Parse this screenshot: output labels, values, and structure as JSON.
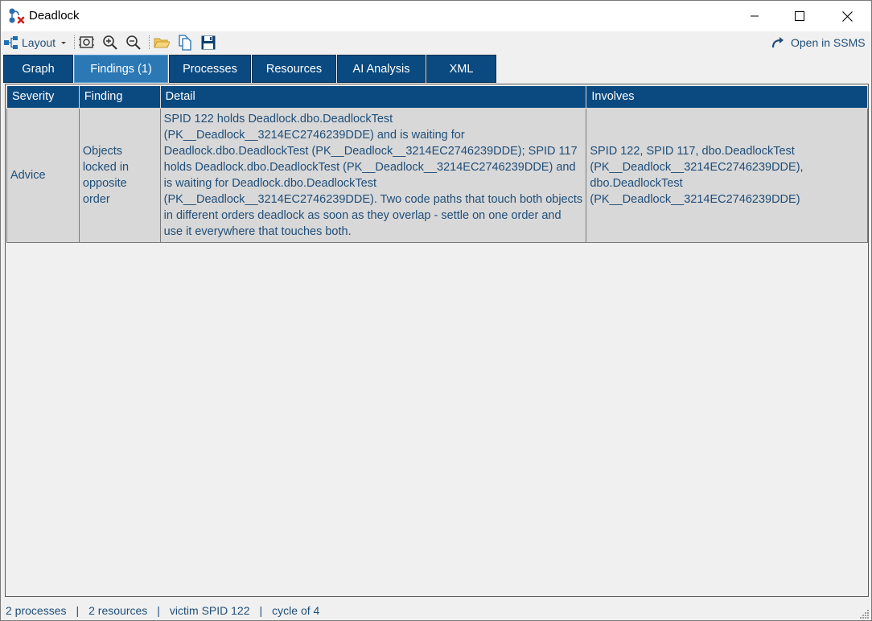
{
  "window": {
    "title": "Deadlock"
  },
  "toolbar": {
    "layout_label": "Layout",
    "open_ssms_label": "Open in SSMS"
  },
  "tabs": [
    {
      "label": "Graph",
      "active": false
    },
    {
      "label": "Findings (1)",
      "active": true
    },
    {
      "label": "Processes",
      "active": false
    },
    {
      "label": "Resources",
      "active": false
    },
    {
      "label": "AI Analysis",
      "active": false
    },
    {
      "label": "XML",
      "active": false
    }
  ],
  "findings": {
    "columns": [
      "Severity",
      "Finding",
      "Detail",
      "Involves"
    ],
    "rows": [
      {
        "severity": "Advice",
        "finding": "Objects locked in opposite order",
        "detail": "SPID 122 holds Deadlock.dbo.DeadlockTest (PK__Deadlock__3214EC2746239DDE) and is waiting for Deadlock.dbo.DeadlockTest (PK__Deadlock__3214EC2746239DDE); SPID 117 holds Deadlock.dbo.DeadlockTest (PK__Deadlock__3214EC2746239DDE) and is waiting for Deadlock.dbo.DeadlockTest (PK__Deadlock__3214EC2746239DDE). Two code paths that touch both objects in different orders deadlock as soon as they overlap - settle on one order and use it everywhere that touches both.",
        "involves": "SPID 122, SPID 117, dbo.DeadlockTest (PK__Deadlock__3214EC2746239DDE), dbo.DeadlockTest (PK__Deadlock__3214EC2746239DDE)"
      }
    ]
  },
  "status": {
    "processes": "2 processes",
    "resources": "2 resources",
    "victim": "victim SPID 122",
    "cycle": "cycle of 4",
    "separator": "|"
  },
  "colors": {
    "tab_bg": "#0a4a80",
    "tab_active_bg": "#2b78b5",
    "header_bg": "#0a4a80",
    "cell_bg": "#d8d8d8",
    "text_blue": "#1f4e79"
  },
  "icons": [
    "deadlock-app-icon",
    "layout-icon",
    "zoom-fit-icon",
    "zoom-in-icon",
    "zoom-out-icon",
    "open-folder-icon",
    "copy-icon",
    "save-icon",
    "open-external-icon",
    "minimize-icon",
    "maximize-icon",
    "close-icon",
    "resize-grip-icon"
  ]
}
